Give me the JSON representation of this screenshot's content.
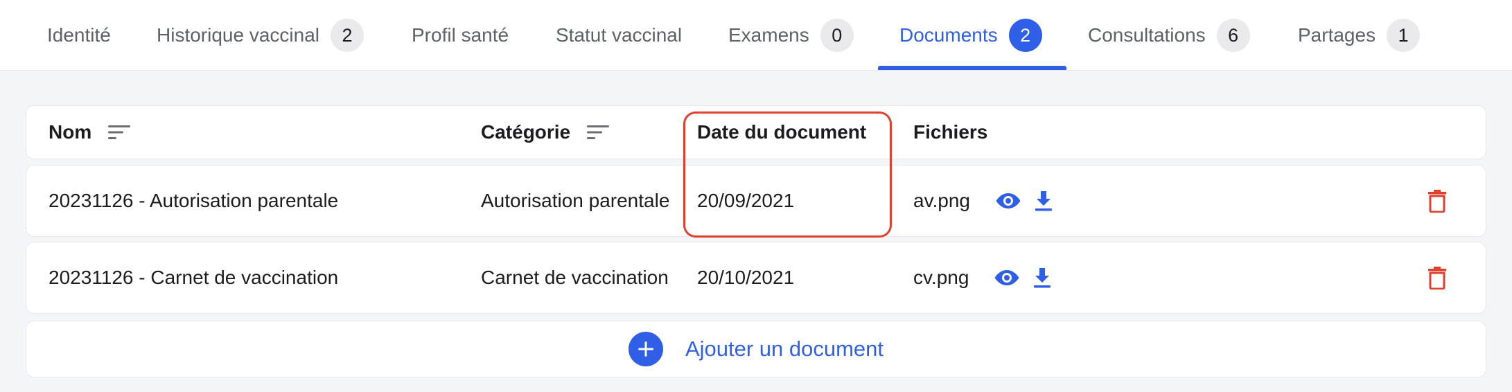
{
  "tabs": [
    {
      "label": "Identité"
    },
    {
      "label": "Historique vaccinal",
      "count": "2"
    },
    {
      "label": "Profil santé"
    },
    {
      "label": "Statut vaccinal"
    },
    {
      "label": "Examens",
      "count": "0"
    },
    {
      "label": "Documents",
      "count": "2",
      "active": true
    },
    {
      "label": "Consultations",
      "count": "6"
    },
    {
      "label": "Partages",
      "count": "1"
    }
  ],
  "table": {
    "columns": [
      "Nom",
      "Catégorie",
      "Date du document",
      "Fichiers"
    ],
    "rows": [
      {
        "name": "20231126 - Autorisation parentale",
        "category": "Autorisation parentale",
        "date": "20/09/2021",
        "file": "av.png"
      },
      {
        "name": "20231126 - Carnet de vaccination",
        "category": "Carnet de vaccination",
        "date": "20/10/2021",
        "file": "cv.png"
      }
    ]
  },
  "add_document": {
    "label": "Ajouter un document"
  },
  "icons": {
    "sort": "sort-icon",
    "view": "eye-icon",
    "download": "download-icon",
    "delete": "trash-icon",
    "add": "plus-icon"
  },
  "colors": {
    "accent": "#2f5fe6",
    "danger": "#e0402b",
    "highlight": "#e0402b"
  }
}
